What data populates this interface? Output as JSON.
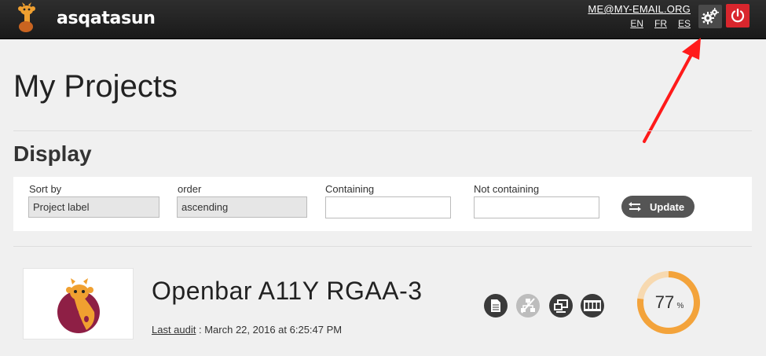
{
  "header": {
    "brand": "asqatasun",
    "user_email": "ME@MY-EMAIL.ORG",
    "languages": [
      "EN",
      "FR",
      "ES"
    ]
  },
  "page": {
    "title": "My Projects"
  },
  "display": {
    "title": "Display",
    "sort_by_label": "Sort by",
    "sort_by_value": "Project label",
    "order_label": "order",
    "order_value": "ascending",
    "containing_label": "Containing",
    "containing_value": "",
    "not_containing_label": "Not containing",
    "not_containing_value": "",
    "update_label": "Update"
  },
  "project": {
    "name": "Openbar A11Y RGAA-3",
    "last_audit_label": "Last audit",
    "last_audit_sep": " : ",
    "last_audit_value": "March 22, 2016 at 6:25:47 PM",
    "score": "77",
    "score_unit": "%",
    "score_fraction": 0.77,
    "icons": [
      "page-audit-icon",
      "site-audit-disabled-icon",
      "multi-page-icon",
      "scenario-icon"
    ]
  },
  "colors": {
    "header_bg": "#222222",
    "brand_accent": "#f0a030",
    "power_button": "#d9262d",
    "score_ring": "#f3a33b",
    "score_track": "#f7d9b0",
    "arrow": "#ff1a1a"
  }
}
